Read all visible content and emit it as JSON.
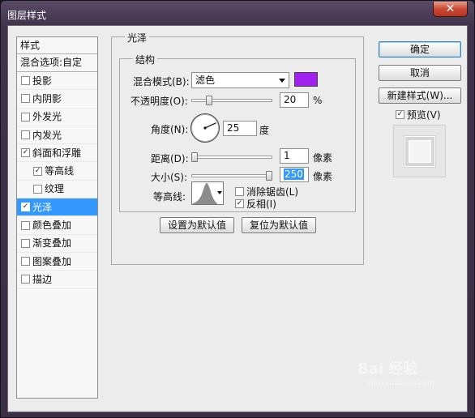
{
  "window": {
    "title": "图层样式",
    "close_glyph": "✕"
  },
  "style_list": {
    "header": "样式",
    "blend_options": "混合选项:自定",
    "items": [
      {
        "label": "投影",
        "checked": false,
        "indent": false,
        "selected": false
      },
      {
        "label": "内阴影",
        "checked": false,
        "indent": false,
        "selected": false
      },
      {
        "label": "外发光",
        "checked": false,
        "indent": false,
        "selected": false
      },
      {
        "label": "内发光",
        "checked": false,
        "indent": false,
        "selected": false
      },
      {
        "label": "斜面和浮雕",
        "checked": true,
        "indent": false,
        "selected": false
      },
      {
        "label": "等高线",
        "checked": true,
        "indent": true,
        "selected": false
      },
      {
        "label": "纹理",
        "checked": false,
        "indent": true,
        "selected": false
      },
      {
        "label": "光泽",
        "checked": true,
        "indent": false,
        "selected": true
      },
      {
        "label": "颜色叠加",
        "checked": false,
        "indent": false,
        "selected": false
      },
      {
        "label": "渐变叠加",
        "checked": false,
        "indent": false,
        "selected": false
      },
      {
        "label": "图案叠加",
        "checked": false,
        "indent": false,
        "selected": false
      },
      {
        "label": "描边",
        "checked": false,
        "indent": false,
        "selected": false
      }
    ]
  },
  "satin": {
    "group_title": "光泽",
    "structure_title": "结构",
    "blend_mode_label": "混合模式(B):",
    "blend_mode_value": "滤色",
    "blend_color": "#a020f0",
    "opacity_label": "不透明度(O):",
    "opacity_value": "20",
    "opacity_unit": "%",
    "angle_label": "角度(N):",
    "angle_value": "25",
    "angle_unit": "度",
    "distance_label": "距离(D):",
    "distance_value": "1",
    "distance_unit": "像素",
    "size_label": "大小(S):",
    "size_value": "250",
    "size_unit": "像素",
    "contour_label": "等高线:",
    "antialias_label": "消除锯齿(L)",
    "antialias_checked": false,
    "invert_label": "反相(I)",
    "invert_checked": true
  },
  "buttons": {
    "make_default": "设置为默认值",
    "reset_default": "复位为默认值",
    "ok": "确定",
    "cancel": "取消",
    "new_style": "新建样式(W)..."
  },
  "preview": {
    "label": "预览(V)",
    "checked": true
  },
  "watermark": {
    "text": "Bai 经验",
    "sub": "jingyan.baidu.com"
  },
  "check_glyph": "✓"
}
